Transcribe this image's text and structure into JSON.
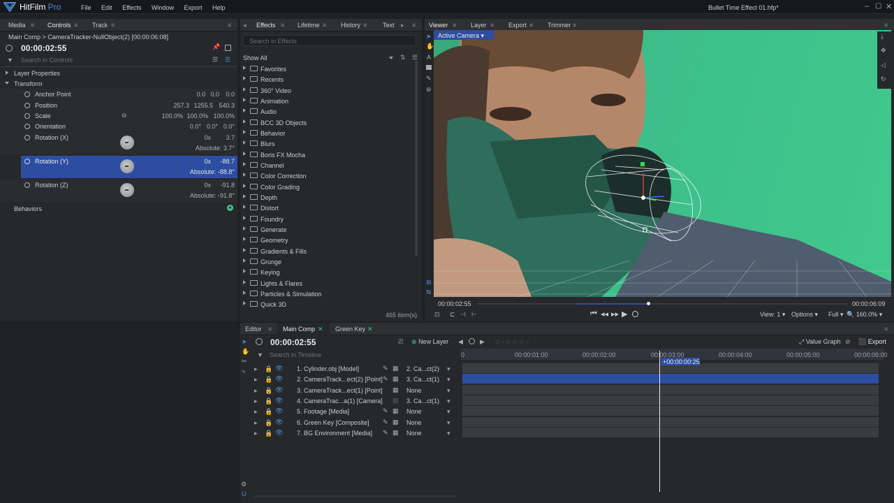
{
  "app": {
    "name": "HitFilm",
    "edition": "Pro",
    "file_title": "Bullet Time Effect 01.hfp*"
  },
  "menu": [
    "File",
    "Edit",
    "Effects",
    "Window",
    "Export",
    "Help"
  ],
  "left_tabs": [
    "Media",
    "Controls",
    "Track"
  ],
  "controls": {
    "breadcrumb": "Main Comp > CameraTracker-NullObject(2) [00:00:06:08]",
    "time": "00:00:02:55",
    "search_placeholder": "Search in Controls",
    "layer_properties": "Layer Properties",
    "transform": "Transform",
    "props": [
      {
        "name": "Anchor Point",
        "values": [
          "0.0",
          "0.0",
          "0.0"
        ]
      },
      {
        "name": "Position",
        "values": [
          "257.3",
          "1255.5",
          "540.3"
        ]
      },
      {
        "name": "Scale",
        "values": [
          "100.0%",
          "100.0%",
          "100.0%"
        ]
      },
      {
        "name": "Orientation",
        "values": [
          "0.0°",
          "0.0°",
          "0.0°"
        ]
      }
    ],
    "rotations": [
      {
        "name": "Rotation (X)",
        "turns": "0x",
        "value": "3.7",
        "absolute": "Absolute: 3.7°"
      },
      {
        "name": "Rotation (Y)",
        "turns": "0x",
        "value": "-88.7",
        "absolute": "Absolute: -88.8°"
      },
      {
        "name": "Rotation (Z)",
        "turns": "0x",
        "value": "-91.8",
        "absolute": "Absolute: -91.8°"
      }
    ],
    "behaviors": "Behaviors"
  },
  "effects_tabs": [
    "Effects",
    "Lifetime",
    "History",
    "Text"
  ],
  "effects": {
    "search_placeholder": "Search in Effects",
    "filter": "Show All",
    "folders": [
      "Favorites",
      "Recents",
      "360° Video",
      "Animation",
      "Audio",
      "BCC 3D Objects",
      "Behavior",
      "Blurs",
      "Boris FX Mocha",
      "Channel",
      "Color Correction",
      "Color Grading",
      "Depth",
      "Distort",
      "Foundry",
      "Generate",
      "Geometry",
      "Gradients & Fills",
      "Grunge",
      "Keying",
      "Lights & Flares",
      "Particles & Simulation",
      "Quick 3D"
    ],
    "count": "465 item(s)"
  },
  "viewer_tabs": [
    "Viewer",
    "Layer",
    "Export",
    "Trimmer"
  ],
  "viewer": {
    "camera": "Active Camera",
    "time_current": "00:00:02:55",
    "time_end": "00:00:06:09",
    "view": "View: 1",
    "options": "Options",
    "quality": "Full",
    "zoom": "160.0%",
    "playhead_fraction": 0.46
  },
  "editor_tabs": [
    "Editor",
    "Main Comp",
    "Green Key"
  ],
  "timeline": {
    "time": "00:00:02:55",
    "new_layer": "New Layer",
    "value_graph": "Value Graph",
    "export": "Export",
    "search_placeholder": "Search in Timeline",
    "ruler": [
      "0",
      "00:00:01:00",
      "00:00:02:00",
      "00:00:03:00",
      "00:00:04:00",
      "00:00:05:00",
      "00:00:06:00"
    ],
    "playhead_label": "+00:00:00:25",
    "layers": [
      {
        "name": "1. Cylinder.obj [Model]",
        "parent": "2. Ca...ct(2)"
      },
      {
        "name": "2. CameraTrack...ect(2) [Point]",
        "parent": "3. Ca...ct(1)"
      },
      {
        "name": "3. CameraTrack...ect(1) [Point]",
        "parent": "None"
      },
      {
        "name": "4. CameraTrac...a(1) [Camera]",
        "parent": "3. Ca...ct(1)"
      },
      {
        "name": "5. Footage [Media]",
        "parent": "None"
      },
      {
        "name": "6. Green Key [Composite]",
        "parent": "None"
      },
      {
        "name": "7. BG Environment [Media]",
        "parent": "None"
      }
    ]
  },
  "colors": {
    "accent": "#2d4ea0",
    "brand": "#4a90d9",
    "green": "#3ec98a",
    "bg": "#1f2125"
  }
}
